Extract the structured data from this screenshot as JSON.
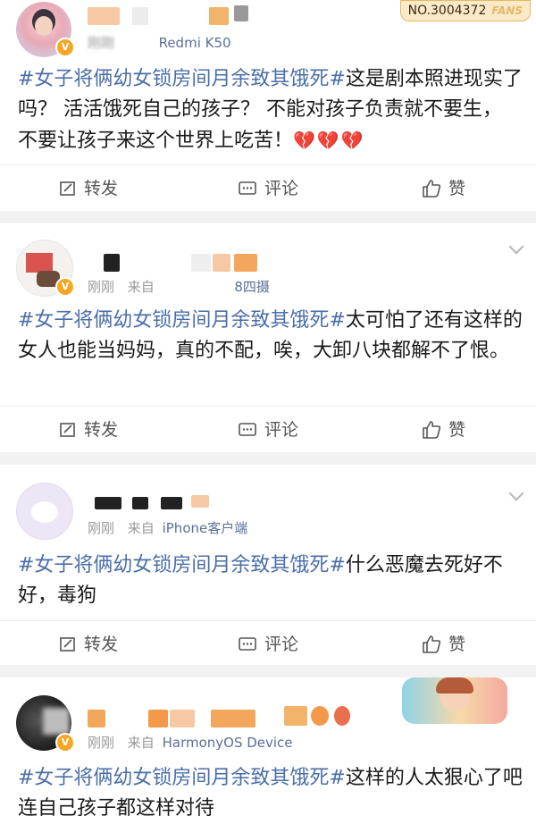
{
  "posts": [
    {
      "meta_time": "刚刚",
      "meta_source": "Redmi K50",
      "fans_badge": "NO.3004372",
      "fans_label": "FANS",
      "hashtag": "#女子将俩幼女锁房间月余致其饿死#",
      "text": "这是剧本照进现实了吗？ 活活饿死自己的孩子？ 不能对孩子负责就不要生， 不要让孩子来这个世界上吃苦！",
      "emoji": "💔💔💔"
    },
    {
      "meta_time": "刚刚",
      "meta_from": "来自",
      "meta_source": "8四摄",
      "hashtag": "#女子将俩幼女锁房间月余致其饿死#",
      "text": "太可怕了还有这样的女人也能当妈妈，真的不配，唉，大卸八块都解不了恨。"
    },
    {
      "meta_time": "刚刚",
      "meta_from": "来自",
      "meta_source": "iPhone客户端",
      "hashtag": "#女子将俩幼女锁房间月余致其饿死#",
      "text": "什么恶魔去死好不好，毒狗"
    },
    {
      "meta_time": "刚刚",
      "meta_from": "来自",
      "meta_source": "HarmonyOS Device",
      "hashtag": "#女子将俩幼女锁房间月余致其饿死#",
      "text": "这样的人太狠心了吧连自己孩子都这样对待"
    }
  ],
  "actions": {
    "repost": "转发",
    "comment": "评论",
    "like": "赞"
  },
  "colors": {
    "hashtag": "#4a6ea9",
    "source": "#5b6f9b",
    "badge": "#f6a623"
  }
}
